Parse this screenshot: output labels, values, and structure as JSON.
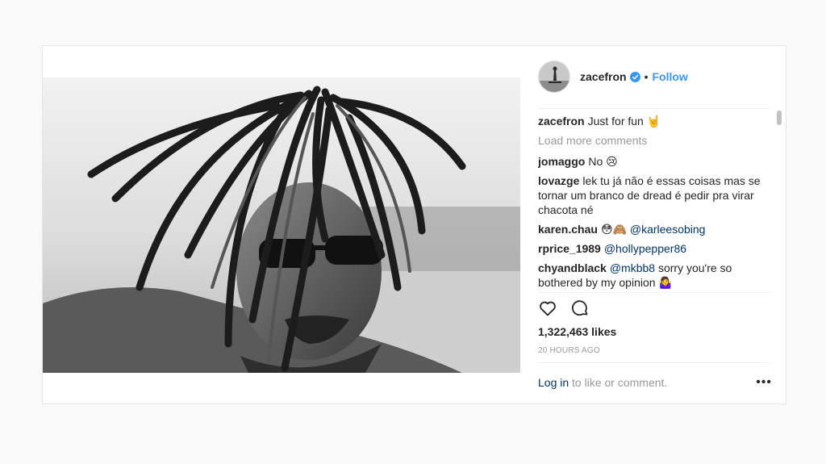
{
  "post": {
    "username": "zacefron",
    "follow_label": "Follow",
    "separator": "•",
    "caption": {
      "user": "zacefron",
      "text": "Just for fun 🤘"
    },
    "load_more": "Load more comments",
    "comments": [
      {
        "user": "jomaggo",
        "text": "No 😢",
        "mention": ""
      },
      {
        "user": "lovazge",
        "text": "lek tu já não é essas coisas mas se tornar um branco de dread é pedir pra virar chacota né",
        "mention": ""
      },
      {
        "user": "karen.chau",
        "text": "😳🙈",
        "mention": "@karleesobing"
      },
      {
        "user": "rprice_1989",
        "text": "",
        "mention": "@hollypepper86"
      },
      {
        "user": "chyandblack",
        "text": "sorry you're so bothered by my opinion 🤷‍♀️",
        "mention": "@mkbb8"
      }
    ],
    "likes": "1,322,463 likes",
    "time": "20 HOURS AGO",
    "login_link": "Log in",
    "login_rest": " to like or comment.",
    "more_label": "•••"
  },
  "colors": {
    "link": "#3897f0",
    "mention": "#003569",
    "muted": "#999999"
  },
  "icons": [
    "verified-badge-icon",
    "heart-icon",
    "comment-icon",
    "more-options-icon"
  ]
}
